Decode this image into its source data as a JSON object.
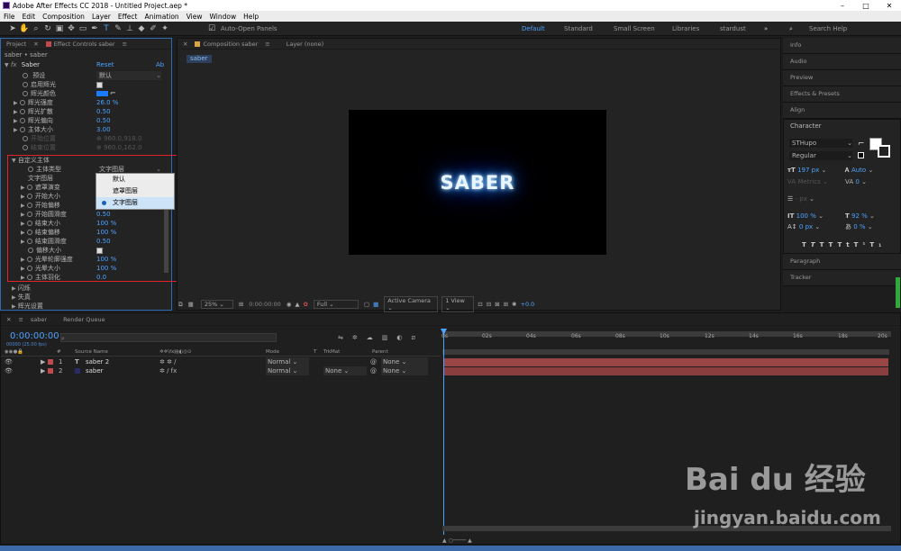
{
  "window": {
    "title": "Adobe After Effects CC 2018 - Untitled Project.aep *",
    "controls": [
      "–",
      "□",
      "✕"
    ]
  },
  "menu": [
    "File",
    "Edit",
    "Composition",
    "Layer",
    "Effect",
    "Animation",
    "View",
    "Window",
    "Help"
  ],
  "toolbar": {
    "auto_open": "Auto-Open Panels",
    "search": "Search Help"
  },
  "workspaces": [
    "Default",
    "Standard",
    "Small Screen",
    "Libraries",
    "stardust"
  ],
  "left_panel": {
    "tab_project": "Project",
    "tab_effect": "Effect Controls saber",
    "breadcrumb": "saber • saber",
    "effect_name": "Saber",
    "reset": "Reset",
    "about": "Ab",
    "props": [
      {
        "label": "预设",
        "value": "默认",
        "type": "dropdown"
      },
      {
        "label": "启用辉光",
        "value": "",
        "type": "check"
      },
      {
        "label": "辉光颜色",
        "value": "",
        "type": "color"
      },
      {
        "label": "辉光强度",
        "value": "26.0 %",
        "type": "num"
      },
      {
        "label": "辉光扩散",
        "value": "0.50",
        "type": "num"
      },
      {
        "label": "辉光偏向",
        "value": "0.50",
        "type": "num"
      },
      {
        "label": "主体大小",
        "value": "3.00",
        "type": "num"
      },
      {
        "label": "开始位置",
        "value": "960.0,918.0",
        "type": "dim"
      },
      {
        "label": "结束位置",
        "value": "960.0,162.0",
        "type": "dim"
      }
    ],
    "custom_group": "自定义主体",
    "custom_props": [
      {
        "label": "主体类型",
        "value": "文字图层",
        "type": "dropdown"
      },
      {
        "label": "文字图层",
        "value": "",
        "type": "plain"
      },
      {
        "label": "遮罩演变",
        "value": "",
        "type": "num"
      },
      {
        "label": "开始大小",
        "value": "",
        "type": "num"
      },
      {
        "label": "开始偏移",
        "value": "",
        "type": "num"
      },
      {
        "label": "开始圆滑度",
        "value": "0.50",
        "type": "num"
      },
      {
        "label": "结束大小",
        "value": "100 %",
        "type": "num"
      },
      {
        "label": "结束偏移",
        "value": "100 %",
        "type": "num"
      },
      {
        "label": "结束圆滑度",
        "value": "0.50",
        "type": "num"
      },
      {
        "label": "偏移大小",
        "value": "",
        "type": "check"
      },
      {
        "label": "光晕轮廓强度",
        "value": "100 %",
        "type": "num"
      },
      {
        "label": "光晕大小",
        "value": "100 %",
        "type": "num"
      },
      {
        "label": "主体羽化",
        "value": "0.0",
        "type": "num"
      }
    ],
    "groups": [
      "闪烁",
      "失真",
      "辉光设置"
    ],
    "dropdown_options": [
      "默认",
      "遮罩图层",
      "文字图层"
    ]
  },
  "comp_panel": {
    "tab_comp": "Composition saber",
    "tab_layer": "Layer (none)",
    "crumb": "saber",
    "text": "SABER",
    "zoom": "25%",
    "time": "0:00:00:00",
    "quality": "Full",
    "camera": "Active Camera",
    "view": "1 View",
    "offset": "+0.0"
  },
  "right_panel": {
    "items": [
      "Info",
      "Audio",
      "Preview",
      "Effects & Presets",
      "Align"
    ],
    "character": "Character",
    "font": "STHupo",
    "style": "Regular",
    "size": "197 px",
    "leading": "Auto",
    "kerning": "Metrics",
    "tracking": "0",
    "stroke": "- px",
    "vscale": "100 %",
    "hscale": "92 %",
    "baseline": "0 px",
    "tsume": "0 %",
    "paragraph": "Paragraph",
    "tracker": "Tracker"
  },
  "timeline": {
    "tab": "saber",
    "tab_render": "Render Queue",
    "timecode": "0:00:00:00",
    "fps": "00000 (25.00 fps)",
    "col_source": "Source Name",
    "col_mode": "Mode",
    "col_t": "T",
    "col_trkmat": "TrkMat",
    "col_parent": "Parent",
    "ticks": [
      "0s",
      "02s",
      "04s",
      "06s",
      "08s",
      "10s",
      "12s",
      "14s",
      "16s",
      "18s",
      "20s"
    ],
    "layers": [
      {
        "num": "1",
        "type": "T",
        "name": "saber 2",
        "mode": "Normal",
        "trkmat": "",
        "parent": "None",
        "color": "#c24a4a"
      },
      {
        "num": "2",
        "type": "",
        "name": "saber",
        "mode": "Normal",
        "trkmat": "None",
        "parent": "None",
        "color": "#2a2a6a"
      }
    ]
  },
  "watermark": {
    "line1": "Bai du 经验",
    "line2": "jingyan.baidu.com"
  }
}
